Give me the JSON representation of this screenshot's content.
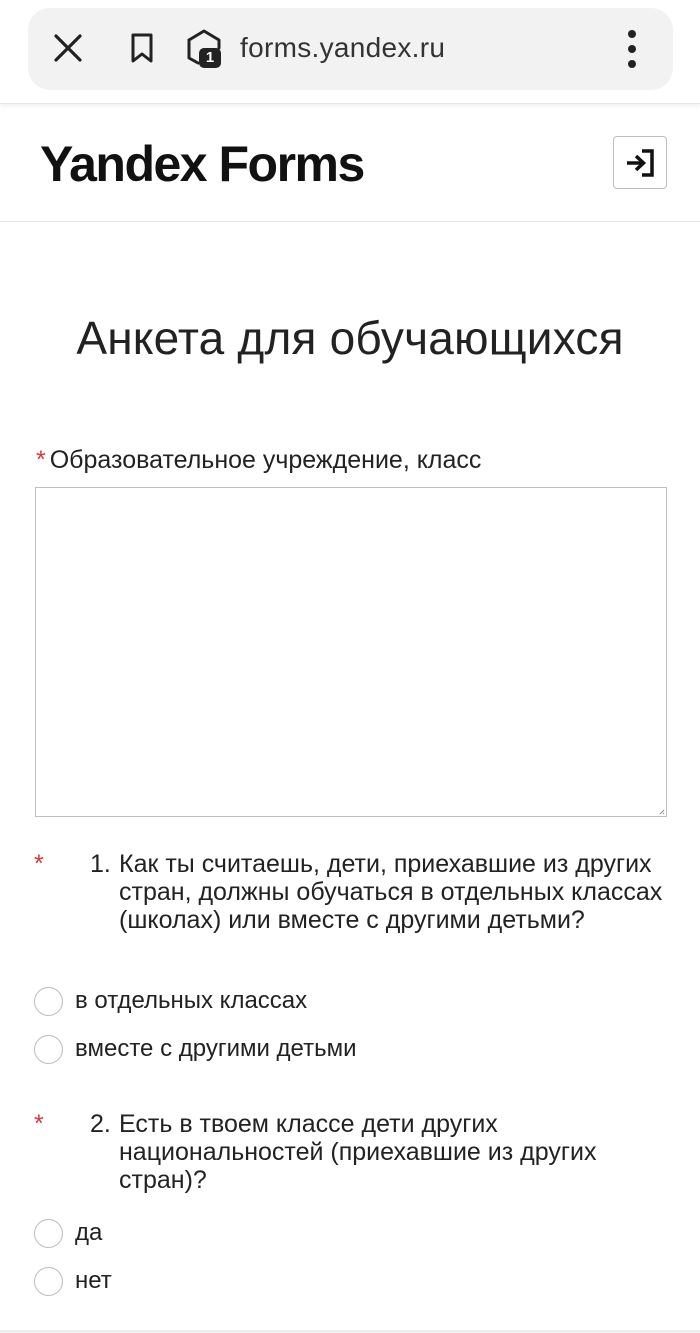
{
  "browser": {
    "url": "forms.yandex.ru",
    "tab_count": "1",
    "icons": {
      "close": "close-icon",
      "bookmark": "bookmark-icon",
      "tabs": "tab-switcher-icon",
      "menu": "more-vertical-icon"
    }
  },
  "header": {
    "logo": "Yandex Forms",
    "login_icon": "login-icon"
  },
  "form": {
    "title": "Анкета для обучающихся",
    "required_marker": "*",
    "field_school": {
      "label": "Образовательное учреждение, класс",
      "value": ""
    },
    "questions": [
      {
        "number": "1.",
        "text": "Как ты считаешь, дети, приехавшие из других стран, должны обучаться в отдельных классах (школах) или вместе с другими детьми?",
        "options": [
          "в отдельных классах",
          "вместе с другими детьми"
        ]
      },
      {
        "number": "2.",
        "text": "Есть в твоем классе дети других национальностей (приехавшие из других стран)?",
        "options": [
          "да",
          "нет"
        ]
      }
    ]
  },
  "colors": {
    "required": "#d93838",
    "text": "#222222",
    "border": "#bfbfbf",
    "address_bar": "#f2f2f2"
  }
}
